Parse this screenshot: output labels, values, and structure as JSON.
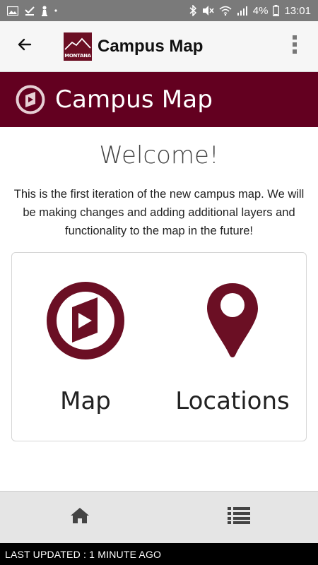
{
  "status_bar": {
    "battery": "4%",
    "time": "13:01"
  },
  "app_bar": {
    "logo_text": "MONTANA",
    "title": "Campus Map"
  },
  "banner": {
    "title": "Campus Map"
  },
  "content": {
    "welcome": "Welcome!",
    "intro": "This is the first iteration of the new campus map. We will be making changes and adding additional layers and functionality to the map in the future!",
    "cards": [
      {
        "label": "Map",
        "icon": "map-compass-icon"
      },
      {
        "label": "Locations",
        "icon": "location-pin-icon"
      }
    ]
  },
  "bottom_nav": {
    "items": [
      {
        "icon": "home-icon"
      },
      {
        "icon": "list-icon"
      }
    ]
  },
  "footer": {
    "text": "LAST UPDATED : 1 MINUTE AGO"
  },
  "colors": {
    "brand": "#630020",
    "icon_maroon": "#6b0f24"
  }
}
